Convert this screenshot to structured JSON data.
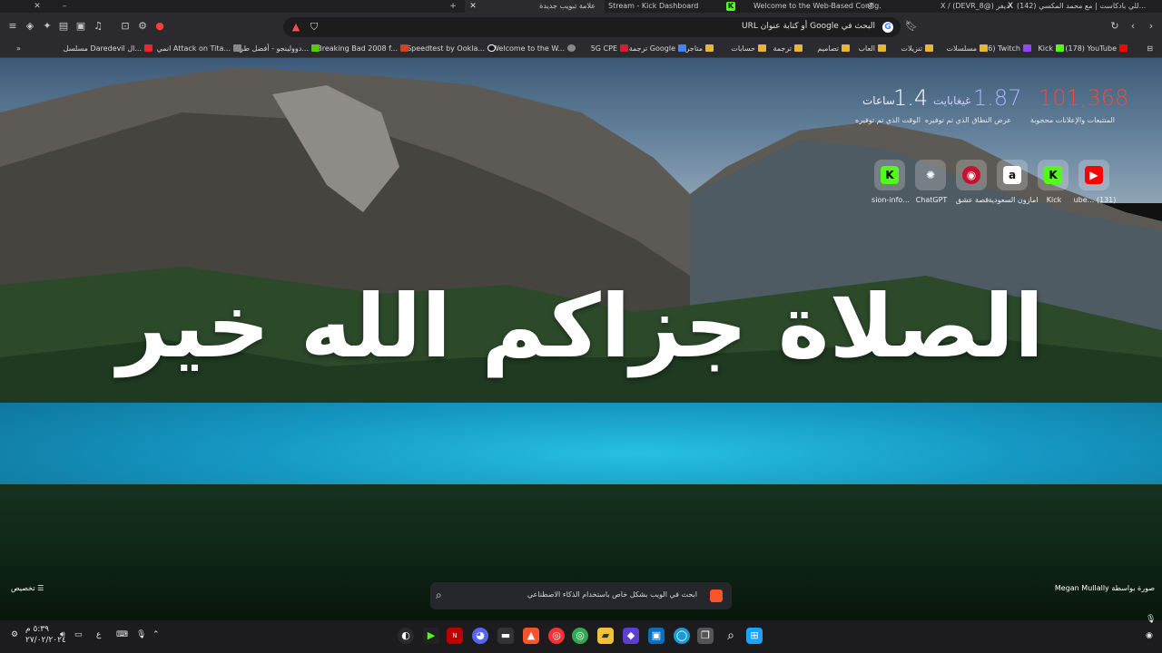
{
  "tabs": [
    {
      "title": "(142) للي بادكاست | مع محمد المكسي..."
    },
    {
      "title": "X / (DEVR_8@) ديفر"
    },
    {
      "title": "Welcome to the Web-Based Config..."
    },
    {
      "title": "Stream - Kick Dashboard"
    },
    {
      "title": "علامة تبويب جديدة"
    }
  ],
  "toolbar": {
    "address_placeholder": "البحث في Google أو كتابة عنوان URL"
  },
  "bookmarks": [
    {
      "label": "(178) YouTube"
    },
    {
      "label": "Kick"
    },
    {
      "label": "(6) Twitch"
    },
    {
      "label": "مسلسلات"
    },
    {
      "label": "تنزيلات"
    },
    {
      "label": "العاب"
    },
    {
      "label": "تصاميم"
    },
    {
      "label": "ترجمة"
    },
    {
      "label": "حسابات"
    },
    {
      "label": "متاجر"
    },
    {
      "label": "ترجمة Google"
    },
    {
      "label": "5G CPE"
    },
    {
      "label": "Welcome to the W..."
    },
    {
      "label": "Speedtest by Ookla..."
    },
    {
      "label": "Breaking Bad 2008 f..."
    },
    {
      "label": "دوولينجو - أفضل طر..."
    },
    {
      "label": "انمي Attack on Tita..."
    },
    {
      "label": "مسلسل Daredevil ال..."
    }
  ],
  "stats": {
    "blocked_value": "101,368",
    "blocked_label": "المتتبعات والإعلانات محجوبة",
    "bandwidth_value": "1.87",
    "bandwidth_unit": "غيغابايت",
    "bandwidth_label": "عرض النطاق الذي تم توفيره",
    "time_value": "1.4",
    "time_unit": "ساعات",
    "time_label": "الوقت الذي تم توفيره"
  },
  "shortcuts": [
    {
      "label": "(131) ...ube"
    },
    {
      "label": "Kick"
    },
    {
      "label": "امازون السعودية"
    },
    {
      "label": "قصة عشق"
    },
    {
      "label": "ChatGPT"
    },
    {
      "label": "...sion-info"
    }
  ],
  "headline": "الصلاة جزاكم الله خير",
  "ntp": {
    "customize_label": "تخصيص",
    "photo_credit": "صورة بواسطة Megan Mullally",
    "ai_search_placeholder": "ابحث في الويب بشكل خاص باستخدام الذكاء الاصطناعي"
  },
  "taskbar": {
    "clock_time": "٥:٣٩ م",
    "clock_date": "٢٧/٠٢/٢٠٢٤",
    "language": "ع"
  },
  "colors": {
    "stats_blocked": "#f24b38",
    "stats_value": "#a5b4ff",
    "brave_orange": "#fb542b",
    "kick_green": "#53fc18",
    "youtube_red": "#ff0000"
  }
}
